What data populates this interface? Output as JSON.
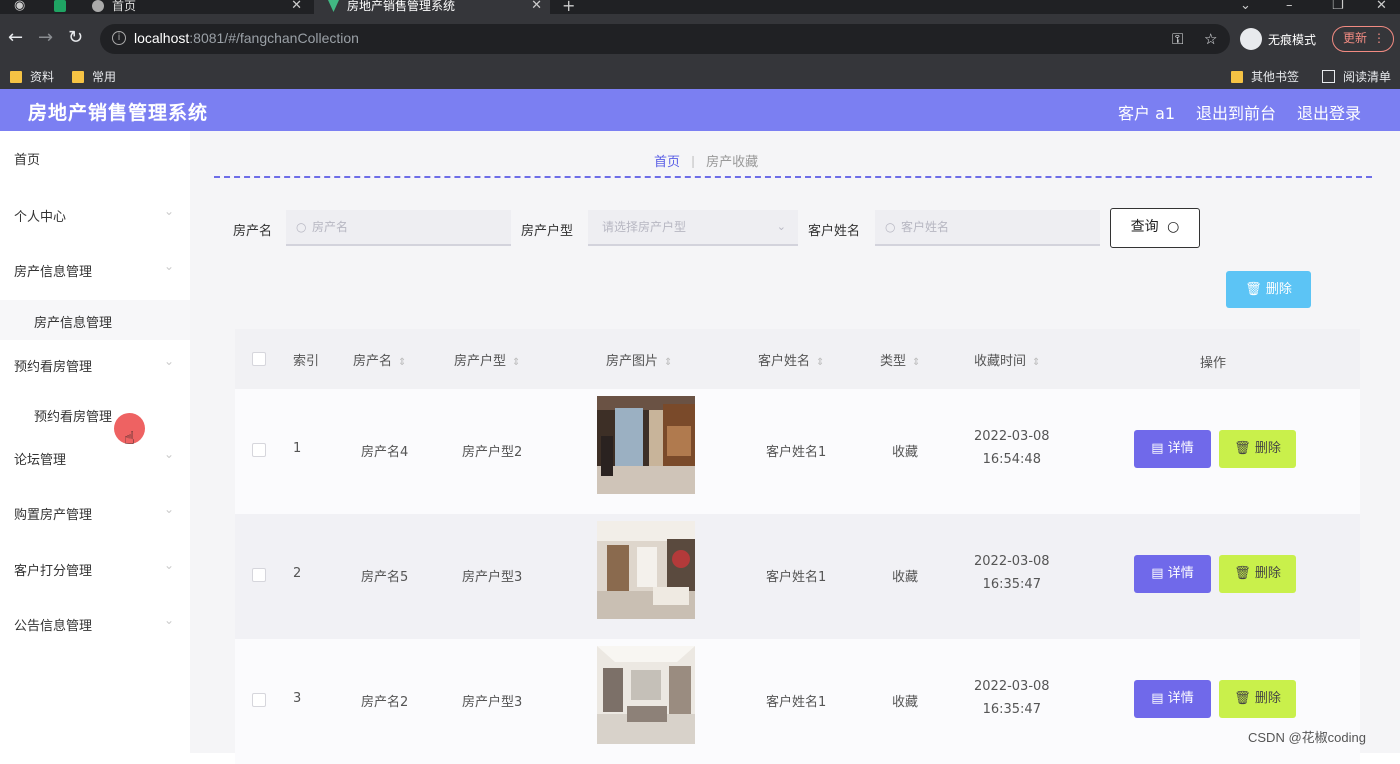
{
  "browser": {
    "tabs": [
      {
        "title": "首页",
        "active": false
      },
      {
        "title": "房地产销售管理系统",
        "active": true
      }
    ],
    "url_host": "localhost",
    "url_rest": ":8081/#/fangchanCollection",
    "incognito_label": "无痕模式",
    "update_label": "更新",
    "bookmarks_left": [
      "资料",
      "常用"
    ],
    "bookmarks_right": [
      "其他书签",
      "阅读清单"
    ]
  },
  "header": {
    "title": "房地产销售管理系统",
    "user": "客户 a1",
    "to_front": "退出到前台",
    "logout": "退出登录"
  },
  "sidebar": {
    "items": [
      {
        "label": "首页"
      },
      {
        "label": "个人中心"
      },
      {
        "label": "房产信息管理"
      },
      {
        "label": "房产信息管理"
      },
      {
        "label": "预约看房管理"
      },
      {
        "label": "预约看房管理"
      },
      {
        "label": "论坛管理"
      },
      {
        "label": "购置房产管理"
      },
      {
        "label": "客户打分管理"
      },
      {
        "label": "公告信息管理"
      }
    ]
  },
  "breadcrumb": {
    "home": "首页",
    "current": "房产收藏"
  },
  "search": {
    "name_label": "房产名",
    "name_placeholder": "房产名",
    "type_label": "房产户型",
    "type_placeholder": "请选择房产户型",
    "customer_label": "客户姓名",
    "customer_placeholder": "客户姓名",
    "query_label": "查询"
  },
  "toolbar": {
    "delete_label": "删除"
  },
  "table": {
    "headers": {
      "index": "索引",
      "name": "房产名",
      "type": "房产户型",
      "photo": "房产图片",
      "customer": "客户姓名",
      "kind": "类型",
      "time": "收藏时间",
      "ops": "操作"
    },
    "rows": [
      {
        "index": "1",
        "name": "房产名4",
        "type": "房产户型2",
        "customer": "客户姓名1",
        "kind": "收藏",
        "date": "2022-03-08",
        "time": "16:54:48"
      },
      {
        "index": "2",
        "name": "房产名5",
        "type": "房产户型3",
        "customer": "客户姓名1",
        "kind": "收藏",
        "date": "2022-03-08",
        "time": "16:35:47"
      },
      {
        "index": "3",
        "name": "房产名2",
        "type": "房产户型3",
        "customer": "客户姓名1",
        "kind": "收藏",
        "date": "2022-03-08",
        "time": "16:35:47"
      }
    ],
    "detail_label": "详情",
    "delete_label": "删除"
  },
  "watermark": "CSDN @花椒coding",
  "colors": {
    "header": "#7b7ff2",
    "detail_button": "#7069ea",
    "delete_button": "#c9f04b",
    "batch_delete": "#5cc4f5"
  }
}
